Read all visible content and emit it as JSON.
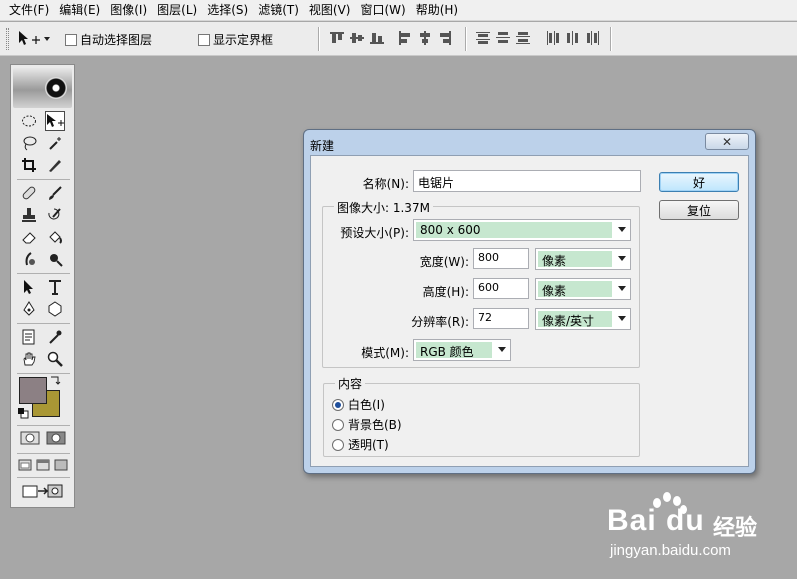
{
  "menubar": {
    "items": [
      "文件(F)",
      "编辑(E)",
      "图像(I)",
      "图层(L)",
      "选择(S)",
      "滤镜(T)",
      "视图(V)",
      "窗口(W)",
      "帮助(H)"
    ]
  },
  "options": {
    "auto_select_label": "自动选择图层",
    "show_bounds_label": "显示定界框"
  },
  "toolbox": {
    "foreground_color": "#8c8084",
    "background_color": "#a99735"
  },
  "dialog": {
    "title": "新建",
    "close_glyph": "✕",
    "name_label": "名称(N):",
    "name_value": "电锯片",
    "image_size_label": "图像大小: 1.37M",
    "preset_label": "预设大小(P):",
    "preset_value": "800 x 600",
    "width_label": "宽度(W):",
    "width_value": "800",
    "width_unit": "像素",
    "height_label": "高度(H):",
    "height_value": "600",
    "height_unit": "像素",
    "resolution_label": "分辨率(R):",
    "resolution_value": "72",
    "resolution_unit": "像素/英寸",
    "mode_label": "模式(M):",
    "mode_value": "RGB 颜色",
    "ok_button": "好",
    "reset_button": "复位",
    "contents_label": "内容",
    "contents_options": [
      "白色(I)",
      "背景色(B)",
      "透明(T)"
    ],
    "contents_selected": 0
  },
  "watermark": {
    "brand": "Bai du",
    "brand_cn": "经验",
    "url": "jingyan.baidu.com"
  },
  "colors": {
    "accent_field": "#c6e7cf",
    "dialog_frame": "#bcd1ea",
    "workspace": "#a7a7a7"
  }
}
